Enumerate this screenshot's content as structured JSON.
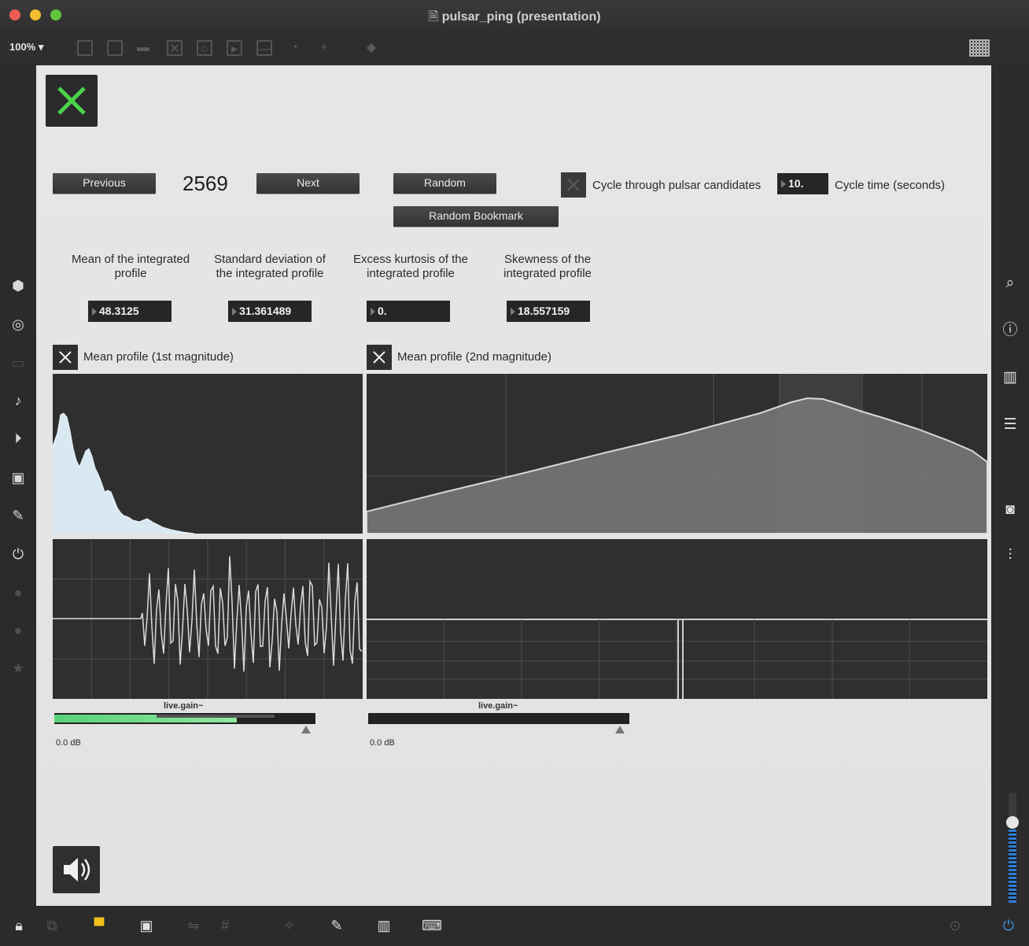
{
  "window": {
    "title": "pulsar_ping (presentation)"
  },
  "toolbar": {
    "zoom": "100%"
  },
  "controls": {
    "previous_label": "Previous",
    "next_label": "Next",
    "random_label": "Random",
    "random_bookmark_label": "Random Bookmark",
    "candidate_index": "2569",
    "cycle_label": "Cycle through pulsar candidates",
    "cycle_time_value": "10.",
    "cycle_time_label": "Cycle time (seconds)"
  },
  "stats": [
    {
      "label": "Mean of the integrated profile",
      "value": "48.3125"
    },
    {
      "label": "Standard deviation of the integrated profile",
      "value": "31.361489"
    },
    {
      "label": "Excess kurtosis of the integrated profile",
      "value": "0."
    },
    {
      "label": "Skewness of the integrated profile",
      "value": "18.557159"
    }
  ],
  "profiles": {
    "first_label": "Mean profile (1st magnitude)",
    "second_label": "Mean profile (2nd magnitude)"
  },
  "gain": {
    "left_label": "live.gain~",
    "left_db": "0.0 dB",
    "left_level": 0.7,
    "right_label": "live.gain~",
    "right_db": "0.0 dB",
    "right_level": 0.0
  },
  "colors": {
    "toggle_on": "#4bd34b",
    "plot_bg": "#2f2f2f",
    "meter_green": "#58d07a"
  },
  "icons": {
    "left_sidebar": [
      "packages-icon",
      "target-icon",
      "inspector-icon",
      "music-note-icon",
      "playlist-icon",
      "image-icon",
      "paperclip-icon",
      "plug-icon",
      "v-icon",
      "b-icon",
      "star-icon"
    ],
    "right_sidebar": [
      "search-icon",
      "info-icon",
      "book-icon",
      "list-icon",
      "camera-icon",
      "mixer-icon"
    ],
    "bottom": [
      "lock-icon",
      "edit-icon",
      "presentation-icon",
      "windows-icon",
      "link-icon",
      "grid-icon",
      "cursor-icon",
      "wrench-icon",
      "piano-icon",
      "keyboard-icon",
      "play-icon",
      "power-icon"
    ]
  }
}
